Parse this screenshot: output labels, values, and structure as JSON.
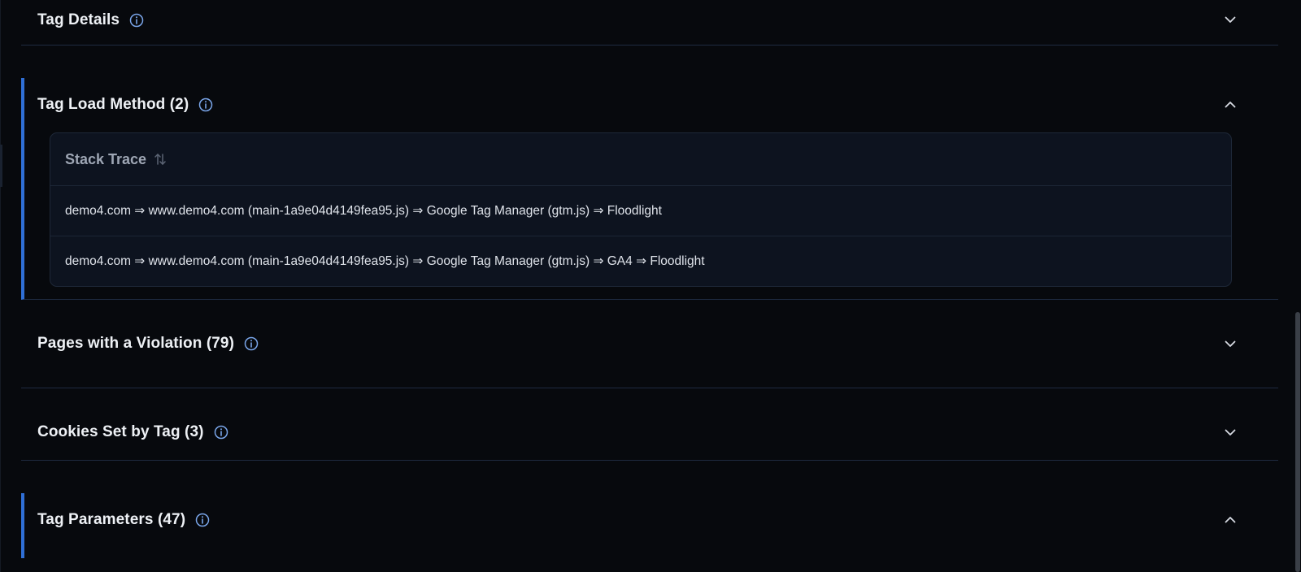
{
  "sections": [
    {
      "id": "tag-details",
      "title": "Tag Details",
      "expanded": false
    },
    {
      "id": "tag-load-method",
      "title": "Tag Load Method (2)",
      "expanded": true,
      "table": {
        "column_header": "Stack Trace",
        "rows": [
          "demo4.com ⇒ www.demo4.com (main-1a9e04d4149fea95.js) ⇒ Google Tag Manager (gtm.js) ⇒ Floodlight",
          "demo4.com ⇒ www.demo4.com (main-1a9e04d4149fea95.js) ⇒ Google Tag Manager (gtm.js) ⇒ GA4 ⇒ Floodlight"
        ]
      }
    },
    {
      "id": "pages-with-violation",
      "title": "Pages with a Violation (79)",
      "expanded": false
    },
    {
      "id": "cookies-set-by-tag",
      "title": "Cookies Set by Tag (3)",
      "expanded": false
    },
    {
      "id": "tag-parameters",
      "title": "Tag Parameters (47)",
      "expanded": true
    }
  ],
  "icons": {
    "info": "info-circle-icon",
    "collapsed": "chevron-down-icon",
    "expanded": "chevron-up-icon",
    "sort": "sort-arrows-icon"
  },
  "colors": {
    "background": "#07090d",
    "accent": "#2f6fd6",
    "info_icon": "#7aa6ea",
    "divider": "#1e2a40",
    "table_bg": "#0d131f"
  }
}
